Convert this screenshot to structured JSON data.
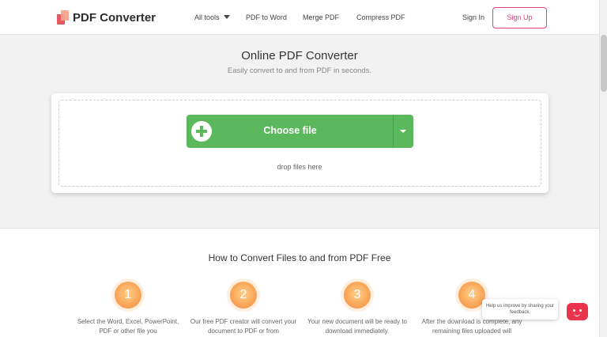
{
  "header": {
    "brand": "PDF Converter",
    "nav": [
      {
        "label": "All tools"
      },
      {
        "label": "PDF to Word"
      },
      {
        "label": "Merge PDF"
      },
      {
        "label": "Compress PDF"
      }
    ],
    "signin_label": "Sign In",
    "signup_label": "Sign Up",
    "accent_color": "#e8407a"
  },
  "hero": {
    "title": "Online PDF Converter",
    "subtitle": "Easily convert to and from PDF in seconds.",
    "choose_label": "Choose file",
    "drop_label": "drop files here",
    "button_color": "#5cb85c"
  },
  "howto": {
    "title": "How to Convert Files to and from PDF Free",
    "steps": [
      {
        "number": "1",
        "text": "Select the Word, Excel, PowerPoint, PDF or other file you"
      },
      {
        "number": "2",
        "text": "Our free PDF creator will convert your document to PDF or from"
      },
      {
        "number": "3",
        "text": "Your new document will be ready to download immediately."
      },
      {
        "number": "4",
        "text": "After the download is complete, any remaining files uploaded will"
      }
    ]
  },
  "feedback": {
    "text": "Help us improve by sharing your feedback."
  }
}
